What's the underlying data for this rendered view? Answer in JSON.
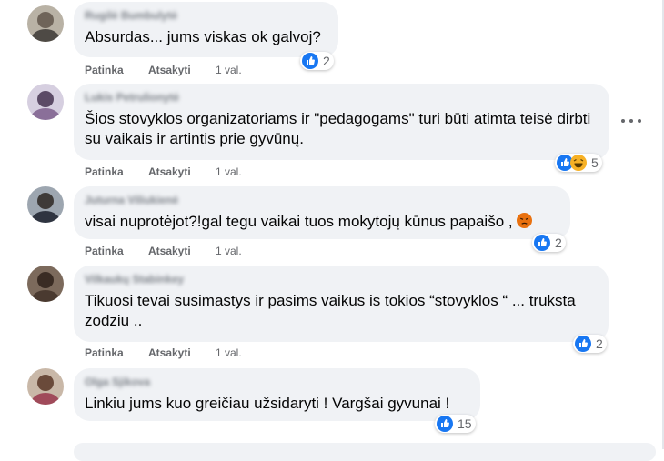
{
  "comments": [
    {
      "author": "Rugilė Bumbulytė",
      "text": "Absurdas... jums viskas ok galvoj?",
      "actions": {
        "like": "Patinka",
        "reply": "Atsakyti",
        "time": "1 val."
      },
      "reactions": {
        "icons": [
          "like-icon"
        ],
        "count": "2"
      }
    },
    {
      "author": "Lukis Petrulionytė",
      "text": "Šios stovyklos organizatoriams ir \"pedagogams\" turi būti atimta teisė dirbti su vaikais ir artintis prie gyvūnų.",
      "actions": {
        "like": "Patinka",
        "reply": "Atsakyti",
        "time": "1 val."
      },
      "reactions": {
        "icons": [
          "like-icon",
          "haha-icon"
        ],
        "count": "5"
      }
    },
    {
      "author": "Juturna Viliukienė",
      "text": "visai nuprotėjot?!gal tegu vaikai tuos mokytojų kūnus papaišo ,",
      "actions": {
        "like": "Patinka",
        "reply": "Atsakyti",
        "time": "1 val."
      },
      "reactions": {
        "icons": [
          "like-icon"
        ],
        "count": "2"
      }
    },
    {
      "author": "Vilkaukų Stabinkey",
      "text": "Tikuosi tevai susimastys ir pasims vaikus is tokios “stovyklos “ ... truksta zodziu ..",
      "actions": {
        "like": "Patinka",
        "reply": "Atsakyti",
        "time": "1 val."
      },
      "reactions": {
        "icons": [
          "like-icon"
        ],
        "count": "2"
      }
    },
    {
      "author": "Olga Sjikova",
      "text": "Linkiu jums kuo greičiau užsidaryti ! Vargšai gyvunai !",
      "actions": {
        "like": "Patinka",
        "reply": "Atsakyti",
        "time": "1 val."
      },
      "reactions": {
        "icons": [
          "like-icon"
        ],
        "count": "15"
      }
    }
  ],
  "colors": {
    "bubble": "#f0f2f5",
    "action_text": "#65676b",
    "like_blue": "#1877f2",
    "haha_yellow": "#f7b125",
    "angry_orange": "#e9710f"
  }
}
